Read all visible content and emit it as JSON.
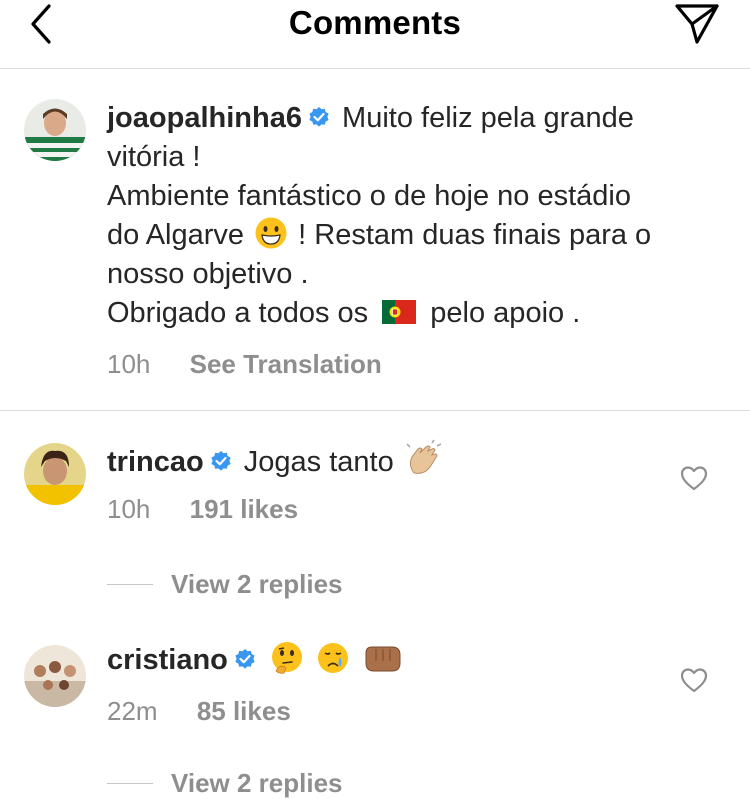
{
  "header": {
    "title": "Comments"
  },
  "caption": {
    "username": "joaopalhinha6",
    "text_line1": "Muito feliz pela grande",
    "text_line2": "vitória !",
    "text_line3": "Ambiente fantástico o de hoje no estádio",
    "text_line4a": "do Algarve",
    "text_line4b": "! Restam duas finais para o",
    "text_line5": "nosso objetivo .",
    "text_line6a": "Obrigado a todos os",
    "text_line6b": "pelo apoio .",
    "time": "10h",
    "translation": "See Translation"
  },
  "comments": [
    {
      "username": "trincao",
      "text": "Jogas tanto",
      "time": "10h",
      "likes": "191 likes",
      "replies": "View 2 replies"
    },
    {
      "username": "cristiano",
      "text": "",
      "time": "22m",
      "likes": "85 likes",
      "replies": "View 2 replies"
    }
  ],
  "colors": {
    "verified": "#3897f0",
    "muted": "#8e8e8e",
    "divider": "#dbdbdb"
  }
}
